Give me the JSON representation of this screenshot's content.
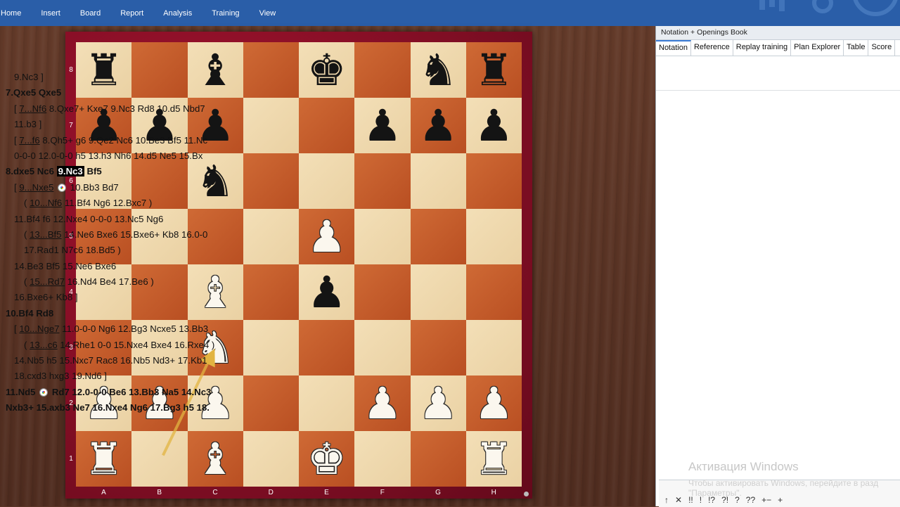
{
  "menu": [
    "Home",
    "Insert",
    "Board",
    "Report",
    "Analysis",
    "Training",
    "View"
  ],
  "board": {
    "ranks": [
      "8",
      "7",
      "6",
      "5",
      "4",
      "3",
      "2",
      "1"
    ],
    "files": [
      "A",
      "B",
      "C",
      "D",
      "E",
      "F",
      "G",
      "H"
    ],
    "rows": [
      [
        "bR",
        "",
        "bB",
        "",
        "bK",
        "",
        "bN",
        "bR"
      ],
      [
        "bP",
        "bP",
        "bP",
        "",
        "",
        "bP",
        "bP",
        "bP"
      ],
      [
        "",
        "",
        "bN",
        "",
        "",
        "",
        "",
        ""
      ],
      [
        "",
        "",
        "",
        "",
        "wP",
        "",
        "",
        ""
      ],
      [
        "",
        "",
        "wB",
        "",
        "bP",
        "",
        "",
        ""
      ],
      [
        "",
        "",
        "wN",
        "",
        "",
        "",
        "",
        ""
      ],
      [
        "wP",
        "wP",
        "wP",
        "",
        "",
        "wP",
        "wP",
        "wP"
      ],
      [
        "wR",
        "",
        "wB",
        "",
        "wK",
        "",
        "",
        "wR"
      ]
    ],
    "arrow": {
      "from": "b1",
      "to": "c3",
      "color": "#e2b441"
    }
  },
  "panel": {
    "title": "Notation + Openings Book",
    "tabs": [
      "Notation",
      "Reference",
      "Replay training",
      "Plan Explorer",
      "Table",
      "Score"
    ],
    "active_tab": "Notation"
  },
  "notation": {
    "l1": "9.Nc3 ]",
    "l2": "7.Qxe5  Qxe5",
    "l3a": "[ ",
    "l3b": "7...Nf6",
    "l3c": "  8.Qxe7+  Kxe7  9.Nc3  Rd8  10.d5  Nbd7",
    "l4": "11.b3 ]",
    "l5a": "[ ",
    "l5b": "7...f6",
    "l5c": "  8.Qh5+  g6  9.Qe2  Nc6  10.Be3  Bf5  11.Nc",
    "l6": "0-0-0  12.0-0-0  h5  13.h3  Nh6  14.d5  Ne5  15.Bx",
    "l7a": "8.dxe5  Nc6  ",
    "l7b": "9.Nc3",
    "l7c": "  Bf5",
    "l8a": "[ ",
    "l8b": "9...Nxe5",
    "l8c": "  10.Bb3  Bd7",
    "l9a": "( ",
    "l9b": "10...Nf6",
    "l9c": "  11.Bf4  Ng6  12.Bxc7 )",
    "l10": "11.Bf4  f6  12.Nxe4  0-0-0  13.Nc5  Ng6",
    "l11a": "( ",
    "l11b": "13...Bf5",
    "l11c": "  14.Ne6  Bxe6  15.Bxe6+  Kb8  16.0-0  ",
    "l12": "17.Rad1  N7c6  18.Bd5 )",
    "l13": "14.Be3  Bf5  15.Ne6  Bxe6",
    "l14a": "( ",
    "l14b": "15...Rd7",
    "l14c": "  16.Nd4  Be4  17.Be6 )",
    "l15": "16.Bxe6+  Kb8 ]",
    "l16": "10.Bf4  Rd8",
    "l17a": "[ ",
    "l17b": "10...Nge7",
    "l17c": "  11.0-0-0  Ng6  12.Bg3  Ncxe5  13.Bb3",
    "l18a": "( ",
    "l18b": "13...c6",
    "l18c": "  14.Rhe1  0-0  15.Nxe4  Bxe4  16.Rxe4 )",
    "l19": "14.Nb5  h5  15.Nxc7  Rac8  16.Nb5  Nd3+  17.Kb1",
    "l20": "18.cxd3  hxg3  19.Nd6 ]",
    "l21a": "11.Nd5 ",
    "l21b": " Rd7  12.0-0-0  Be6  13.Bb3  Na5  14.Nc3",
    "l22": "Nxb3+  15.axb3  Ne7  16.Nxe4  Ng6  17.Bg3  h5  18."
  },
  "watermark": {
    "title": "Активация Windows",
    "subtitle": "Чтобы активировать Windows, перейдите в разд",
    "subtitle2": "\"Параметры\"."
  },
  "symbols": [
    "↑",
    "✕",
    "!!",
    "!",
    "!?",
    "?!",
    "?",
    "??",
    "+−",
    "+"
  ]
}
